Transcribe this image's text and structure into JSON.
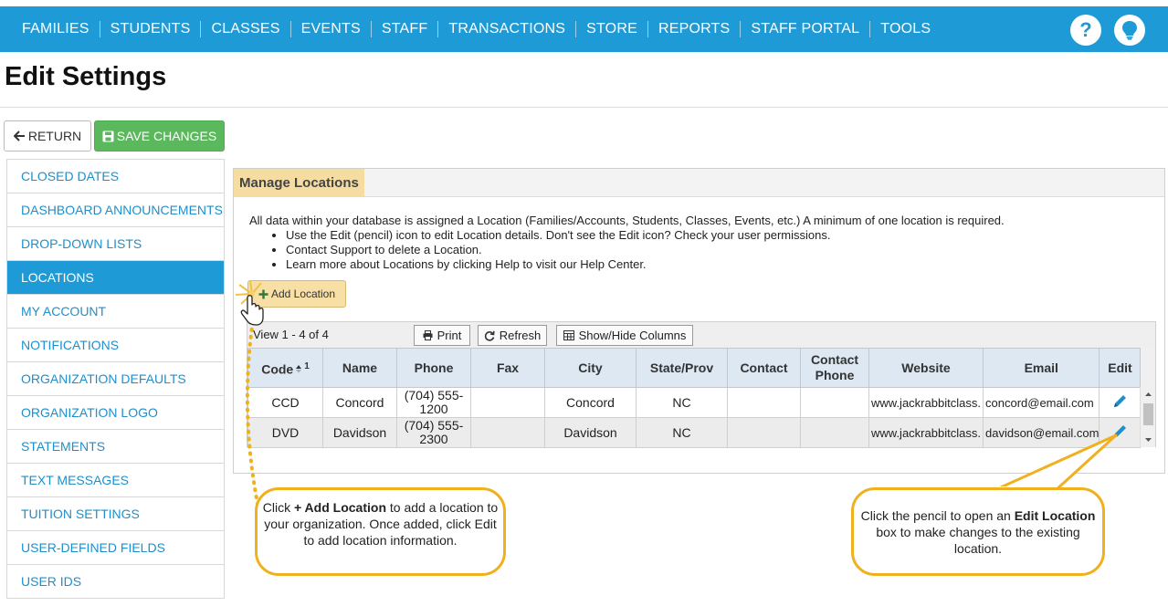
{
  "nav": {
    "links": [
      "FAMILIES",
      "STUDENTS",
      "CLASSES",
      "EVENTS",
      "STAFF",
      "TRANSACTIONS",
      "STORE",
      "REPORTS",
      "STAFF PORTAL",
      "TOOLS"
    ],
    "help_icon": "question-circle-icon",
    "bulb_icon": "lightbulb-icon",
    "color": "#1e9ad6"
  },
  "page": {
    "title": "Edit Settings"
  },
  "actions": {
    "return_label": "RETURN",
    "save_label": "SAVE CHANGES"
  },
  "sidebar": {
    "items": [
      "CLOSED DATES",
      "DASHBOARD ANNOUNCEMENTS",
      "DROP-DOWN LISTS",
      "LOCATIONS",
      "MY ACCOUNT",
      "NOTIFICATIONS",
      "ORGANIZATION DEFAULTS",
      "ORGANIZATION LOGO",
      "STATEMENTS",
      "TEXT MESSAGES",
      "TUITION SETTINGS",
      "USER-DEFINED FIELDS",
      "USER IDS"
    ],
    "active": "LOCATIONS"
  },
  "panel": {
    "title": "Manage Locations",
    "intro": "All data within your database is assigned a Location (Families/Accounts, Students, Classes, Events, etc.) A minimum of one location is required.",
    "bullets": [
      "Use the Edit (pencil) icon to edit Location details. Don't see the Edit icon? Check your user permissions.",
      "Contact Support to delete a Location.",
      "Learn more about Locations by clicking Help to visit our Help Center."
    ],
    "add_label": "Add Location"
  },
  "grid": {
    "view_label": "View 1 - 4 of 4",
    "print_label": "Print",
    "refresh_label": "Refresh",
    "showhide_label": "Show/Hide Columns",
    "sort_indicator": "1",
    "columns": [
      "Code",
      "Name",
      "Phone",
      "Fax",
      "City",
      "State/Prov",
      "Contact",
      "Contact Phone",
      "Website",
      "Email",
      "Edit"
    ],
    "rows": [
      {
        "code": "CCD",
        "name": "Concord",
        "phone": "(704) 555-1200",
        "fax": "",
        "city": "Concord",
        "state": "NC",
        "contact": "",
        "contact_phone": "",
        "website": "www.jackrabbitclass.",
        "email": "concord@email.com"
      },
      {
        "code": "DVD",
        "name": "Davidson",
        "phone": "(704) 555-2300",
        "fax": "",
        "city": "Davidson",
        "state": "NC",
        "contact": "",
        "contact_phone": "",
        "website": "www.jackrabbitclass.",
        "email": "davidson@email.com"
      }
    ]
  },
  "callouts": {
    "left": {
      "pre": "Click ",
      "bold": "+ Add Location",
      "post": " to add a location to your organization. Once added, click Edit to add location information."
    },
    "right": {
      "pre": "Click the pencil to open an ",
      "bold": "Edit Location",
      "post": " box to make changes to the existing location."
    }
  }
}
